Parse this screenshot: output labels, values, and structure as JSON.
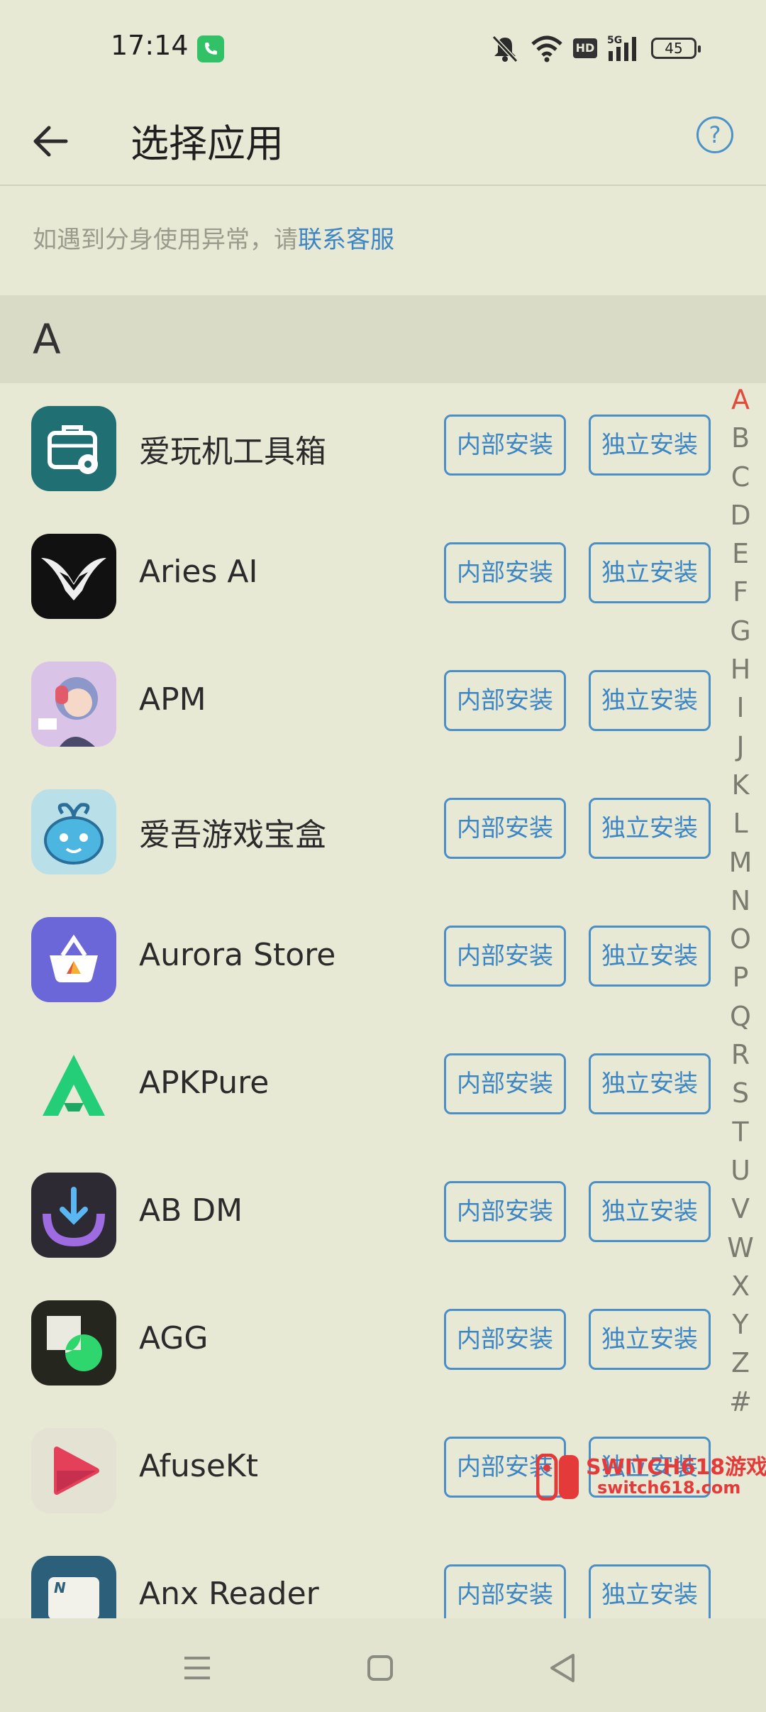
{
  "status_bar": {
    "time": "17:14",
    "battery": "45",
    "network": "HD",
    "signal_type": "5G",
    "icons": [
      "phone-call-icon",
      "mute-bell-icon",
      "wifi-icon",
      "hd-icon",
      "signal-5g-icon",
      "battery-icon"
    ]
  },
  "header": {
    "title": "选择应用",
    "back_icon": "back-arrow-icon",
    "help_icon": "?"
  },
  "notice": {
    "text": "如遇到分身使用异常，请",
    "link": "联系客服"
  },
  "section": {
    "letter": "A"
  },
  "buttons": {
    "internal": "内部安装",
    "standalone": "独立安装"
  },
  "apps": [
    {
      "name": "爱玩机工具箱",
      "icon": "toolbox-icon"
    },
    {
      "name": "Aries AI",
      "icon": "aries-ai-icon"
    },
    {
      "name": "APM",
      "icon": "apm-avatar-icon"
    },
    {
      "name": "爱吾游戏宝盒",
      "icon": "game-box-icon"
    },
    {
      "name": "Aurora Store",
      "icon": "aurora-store-icon"
    },
    {
      "name": "APKPure",
      "icon": "apkpure-icon"
    },
    {
      "name": "AB DM",
      "icon": "ab-dm-icon"
    },
    {
      "name": "AGG",
      "icon": "agg-icon"
    },
    {
      "name": "AfuseKt",
      "icon": "afusekt-icon"
    },
    {
      "name": "Anx Reader",
      "icon": "anx-reader-icon"
    }
  ],
  "index_letters": [
    "A",
    "B",
    "C",
    "D",
    "E",
    "F",
    "G",
    "H",
    "I",
    "J",
    "K",
    "L",
    "M",
    "N",
    "O",
    "P",
    "Q",
    "R",
    "S",
    "T",
    "U",
    "V",
    "W",
    "X",
    "Y",
    "Z",
    "#"
  ],
  "active_index": "A",
  "watermark": {
    "line1": "SWITCH618游戏",
    "line2": "switch618.com"
  },
  "nav_bar": {
    "icons": [
      "menu-icon",
      "home-icon",
      "back-icon"
    ]
  },
  "colors": {
    "accent": "#3d86c6",
    "active_index": "#e14a3c",
    "background": "#e8e9d4"
  }
}
